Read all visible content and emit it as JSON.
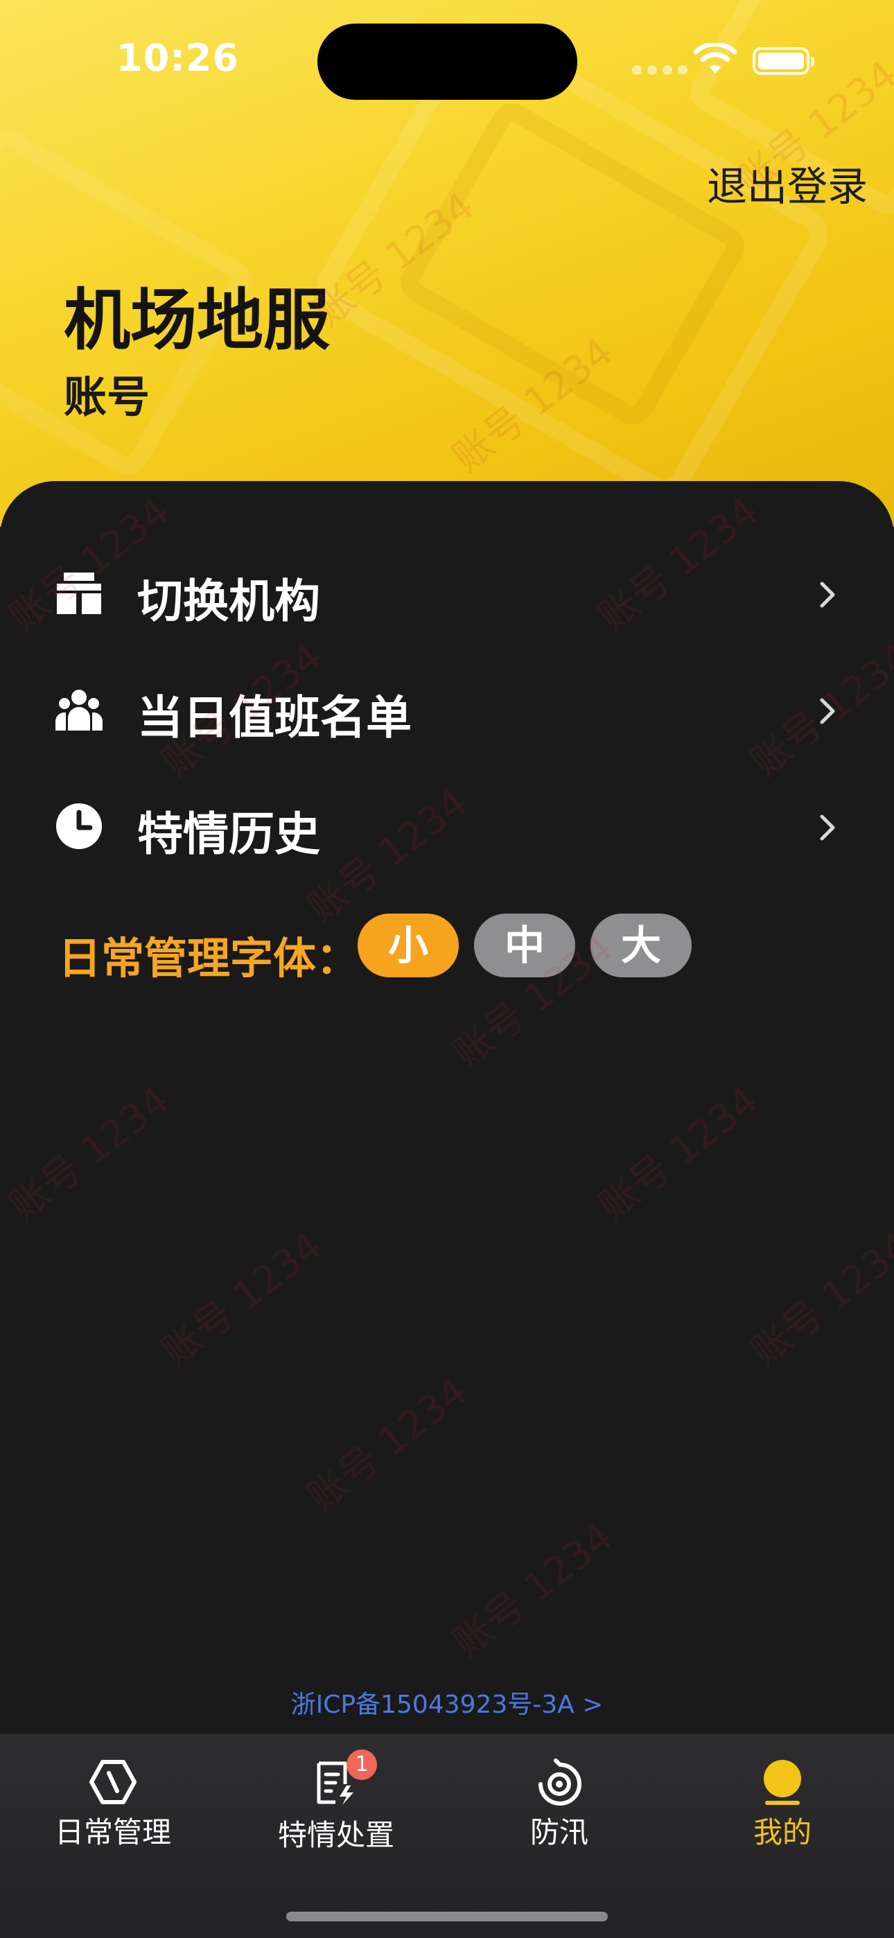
{
  "status_bar": {
    "time": "10:26"
  },
  "header": {
    "logout_label": "退出登录",
    "org_name": "机场地服",
    "account_label": "账号"
  },
  "menu": {
    "items": [
      {
        "label": "切换机构",
        "icon": "switch-org-icon"
      },
      {
        "label": "当日值班名单",
        "icon": "people-icon"
      },
      {
        "label": "特情历史",
        "icon": "clock-icon"
      }
    ]
  },
  "font_size": {
    "label": "日常管理字体：",
    "options": [
      "小",
      "中",
      "大"
    ],
    "selected": "小"
  },
  "footer": {
    "icp": "浙ICP备15043923号-3A >"
  },
  "tabbar": {
    "tabs": [
      {
        "label": "日常管理",
        "icon": "hexagon-icon",
        "active": false
      },
      {
        "label": "特情处置",
        "icon": "document-bolt-icon",
        "active": false,
        "badge": "1"
      },
      {
        "label": "防汛",
        "icon": "eye-icon",
        "active": false
      },
      {
        "label": "我的",
        "icon": "user-icon",
        "active": true
      }
    ]
  },
  "watermark": {
    "text": "账号 1234"
  },
  "colors": {
    "header_yellow": "#f7d52c",
    "panel_bg": "#1a1a1b",
    "accent_orange": "#f6a41d",
    "tab_active": "#f2c318",
    "badge_red": "#f1665a",
    "icp_blue": "#4d78e0"
  }
}
